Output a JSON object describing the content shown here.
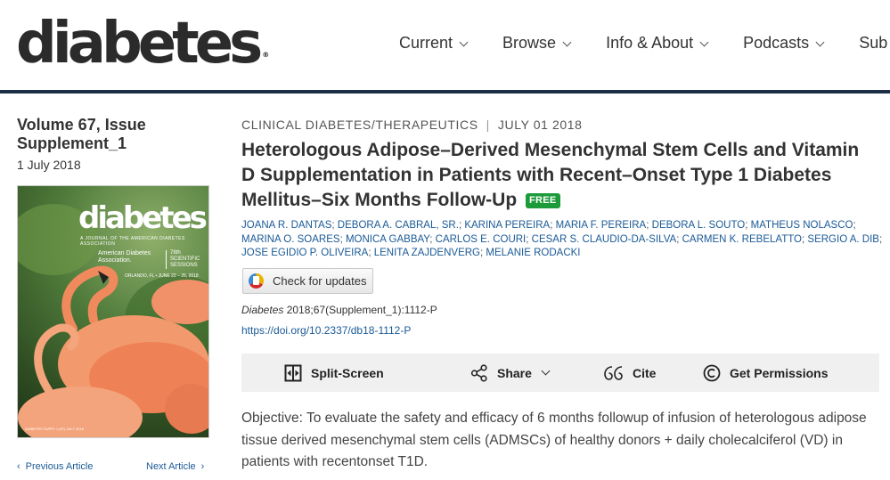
{
  "header": {
    "logo_text": "diabetes",
    "logo_mark": "®",
    "nav": [
      {
        "label": "Current"
      },
      {
        "label": "Browse"
      },
      {
        "label": "Info & About"
      },
      {
        "label": "Podcasts"
      },
      {
        "label": "Sub"
      }
    ]
  },
  "issue": {
    "title": "Volume 67, Issue Supplement_1",
    "date": "1 July 2018",
    "cover": {
      "logo": "diabetes",
      "subtitle": "A JOURNAL OF THE AMERICAN DIABETES ASSOCIATION",
      "ada": "American Diabetes Association.",
      "sessions": "78th SCIENTIFIC SESSIONS",
      "city": "ORLANDO, FL • JUNE 22 – 26, 2018",
      "code": "DIABETES SUPPL 1 (67) JULY 2018"
    },
    "prev_label": "Previous Article",
    "next_label": "Next Article"
  },
  "article": {
    "category": "CLINICAL DIABETES/THERAPEUTICS",
    "separator": "|",
    "date": "JULY 01 2018",
    "title": "Heterologous Adipose–Derived Mesenchymal Stem Cells and Vitamin D Supplementation in Patients with Recent–Onset Type 1 Diabetes Mellitus–Six Months Follow-Up",
    "free_badge": "FREE",
    "authors": [
      "JOANA R. DANTAS",
      "DEBORA A. CABRAL, SR.",
      "KARINA PEREIRA",
      "MARIA F. PEREIRA",
      "DEBORA L. SOUTO",
      "MATHEUS NOLASCO",
      "MARINA O. SOARES",
      "MONICA GABBAY",
      "CARLOS E. COURI",
      "CESAR S. CLAUDIO-DA-SILVA",
      "CARMEN K. REBELATTO",
      "SERGIO A. DIB",
      "JOSE EGIDIO P. OLIVEIRA",
      "LENITA ZAJDENVERG",
      "MELANIE RODACKI"
    ],
    "author_separator": ";",
    "check_updates_label": "Check for updates",
    "citation_journal": "Diabetes",
    "citation_rest": " 2018;67(Supplement_1):1112-P",
    "doi": "https://doi.org/10.2337/db18-1112-P",
    "abstract": "Objective: To evaluate the safety and efficacy of 6 months followup of infusion of heterologous adipose tissue derived mesenchymal stem cells (ADMSCs) of healthy donors + daily cholecalciferol (VD) in patients with recentonset T1D."
  },
  "toolbar": {
    "split_screen": "Split-Screen",
    "share": "Share",
    "cite": "Cite",
    "permissions": "Get Permissions"
  },
  "colors": {
    "header_rule": "#1b3047",
    "link": "#1a5a96",
    "free_badge": "#1b9b3a",
    "toolbar_bg": "#f0f0f0"
  },
  "icons": {
    "split_screen": "split-screen-icon",
    "share": "share-icon",
    "cite": "quote-icon",
    "permissions": "copyright-icon",
    "check_updates": "crossmark-icon"
  }
}
